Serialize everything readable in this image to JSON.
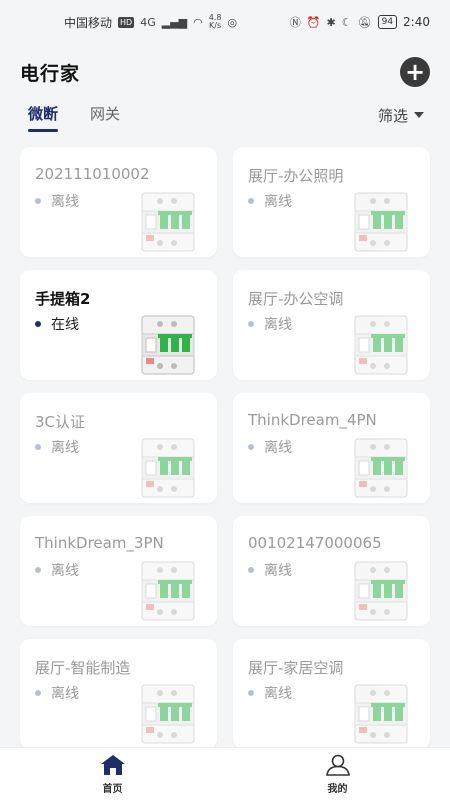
{
  "status_bar": {
    "carrier": "中国移动",
    "hd": "HD",
    "network": "4G",
    "speed_value": "4.8",
    "speed_unit": "K/s",
    "battery": "94",
    "time": "2:40"
  },
  "header": {
    "title": "电行家",
    "add_icon": "plus-icon"
  },
  "tabs": [
    {
      "label": "微断",
      "active": true
    },
    {
      "label": "网关",
      "active": false
    }
  ],
  "filter": {
    "label": "筛选"
  },
  "devices": [
    {
      "name": "202111010002",
      "status": "离线"
    },
    {
      "name": "展厅-办公照明",
      "status": "离线"
    },
    {
      "name": "手提箱2",
      "status": "在线"
    },
    {
      "name": "展厅-办公空调",
      "status": "离线"
    },
    {
      "name": "3C认证",
      "status": "离线"
    },
    {
      "name": "ThinkDream_4PN",
      "status": "离线"
    },
    {
      "name": "ThinkDream_3PN",
      "status": "离线"
    },
    {
      "name": "00102147000065",
      "status": "离线"
    },
    {
      "name": "展厅-智能制造",
      "status": "离线"
    },
    {
      "name": "展厅-家居空调",
      "status": "离线"
    }
  ],
  "bottom_nav": [
    {
      "label": "首页",
      "icon": "home-icon",
      "active": true
    },
    {
      "label": "我的",
      "icon": "user-icon",
      "active": false
    }
  ],
  "colors": {
    "accent": "#1e2e6b",
    "offline_text": "#9a9a9a",
    "breaker_green": "#2fb34a"
  }
}
